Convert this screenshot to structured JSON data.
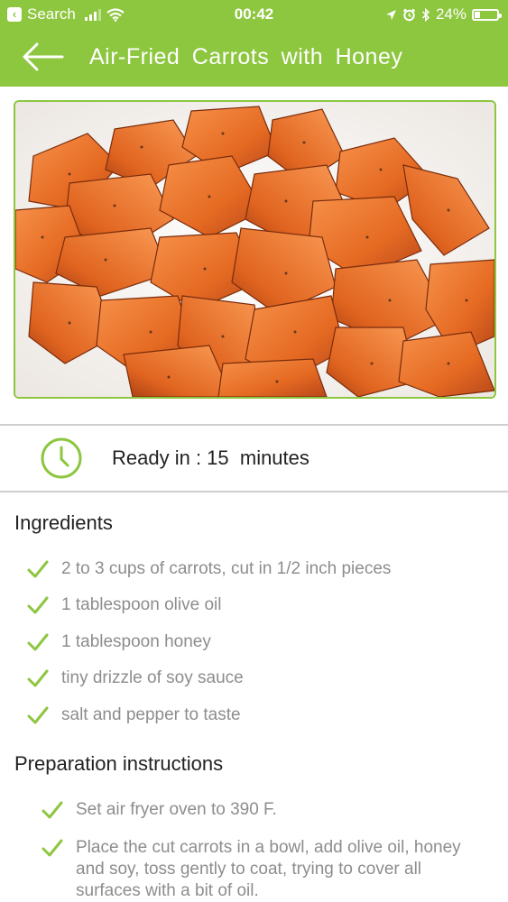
{
  "status_bar": {
    "back_app_label": "Search",
    "time": "00:42",
    "battery": "24%",
    "signal_icon": "signal-bars-icon",
    "wifi_icon": "wifi-icon",
    "battery_level": 0.24
  },
  "nav": {
    "title": "Air-Fried  Carrots  with  Honey",
    "back_icon": "back-arrow-icon"
  },
  "hero": {
    "image": "roasted-carrots-photo"
  },
  "ready": {
    "icon": "clock-icon",
    "text": "Ready in : 15  minutes"
  },
  "ingredients": {
    "title": "Ingredients",
    "items": [
      "2 to 3 cups of carrots, cut in 1/2 inch pieces",
      "1 tablespoon olive oil",
      "1 tablespoon honey",
      "tiny drizzle of soy sauce",
      "salt and pepper to taste"
    ]
  },
  "preparation": {
    "title": "Preparation instructions",
    "items": [
      "Set air fryer oven to 390 F.",
      "Place the cut carrots in a bowl, add olive oil, honey and soy, toss gently to coat, trying to cover all surfaces with a bit of oil."
    ]
  },
  "colors": {
    "accent": "#8dc63f",
    "text": "#222222",
    "muted": "#8d8d8d"
  }
}
